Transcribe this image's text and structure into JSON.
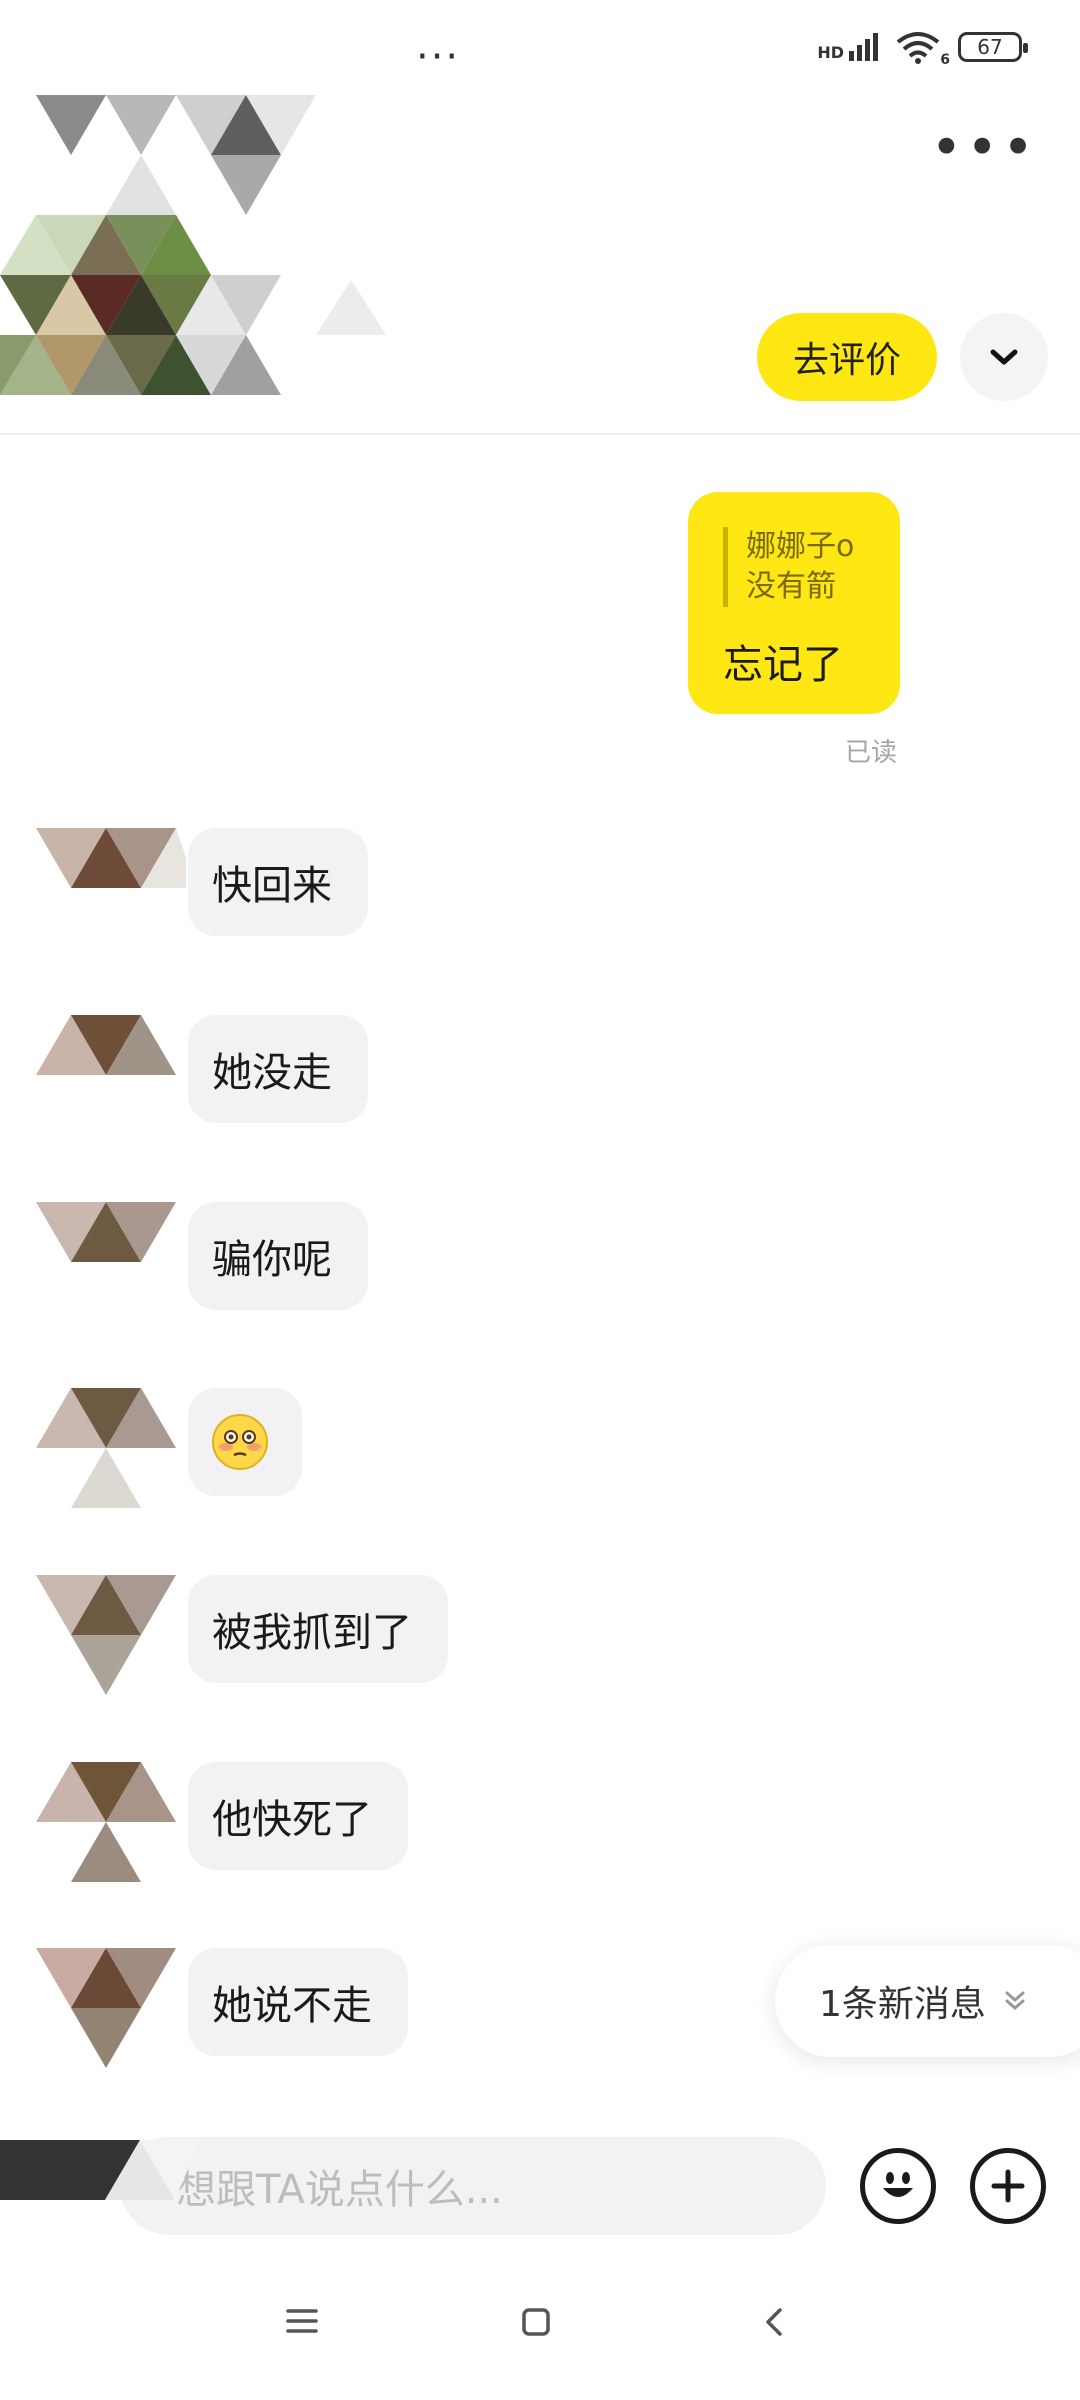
{
  "status_bar": {
    "dots": "···",
    "network": "HD",
    "wifi_badge": "6",
    "battery": "67"
  },
  "header": {
    "more_label": "•••",
    "review_button": "去评价",
    "collapse_icon": "chevron-down-icon"
  },
  "sent_message": {
    "quote_lines": [
      "娜娜子o",
      "没有箭"
    ],
    "text": "忘记了",
    "read_status": "已读"
  },
  "received_messages": [
    {
      "text": "快回来"
    },
    {
      "text": "她没走"
    },
    {
      "text": "骗你呢"
    },
    {
      "text": "",
      "emoji": "flushed-face-emoji"
    },
    {
      "text": "被我抓到了"
    },
    {
      "text": "他快死了"
    },
    {
      "text": "她说不走"
    }
  ],
  "new_message_pill": {
    "label": "1条新消息"
  },
  "input_bar": {
    "placeholder": "想跟TA说点什么..."
  },
  "colors": {
    "accent_yellow": "#ffe713",
    "bubble_gray": "#f2f2f4",
    "text_dark": "#1a1a1a"
  },
  "nav_bar": {
    "icons": [
      "menu-icon",
      "home-icon",
      "back-icon"
    ]
  }
}
